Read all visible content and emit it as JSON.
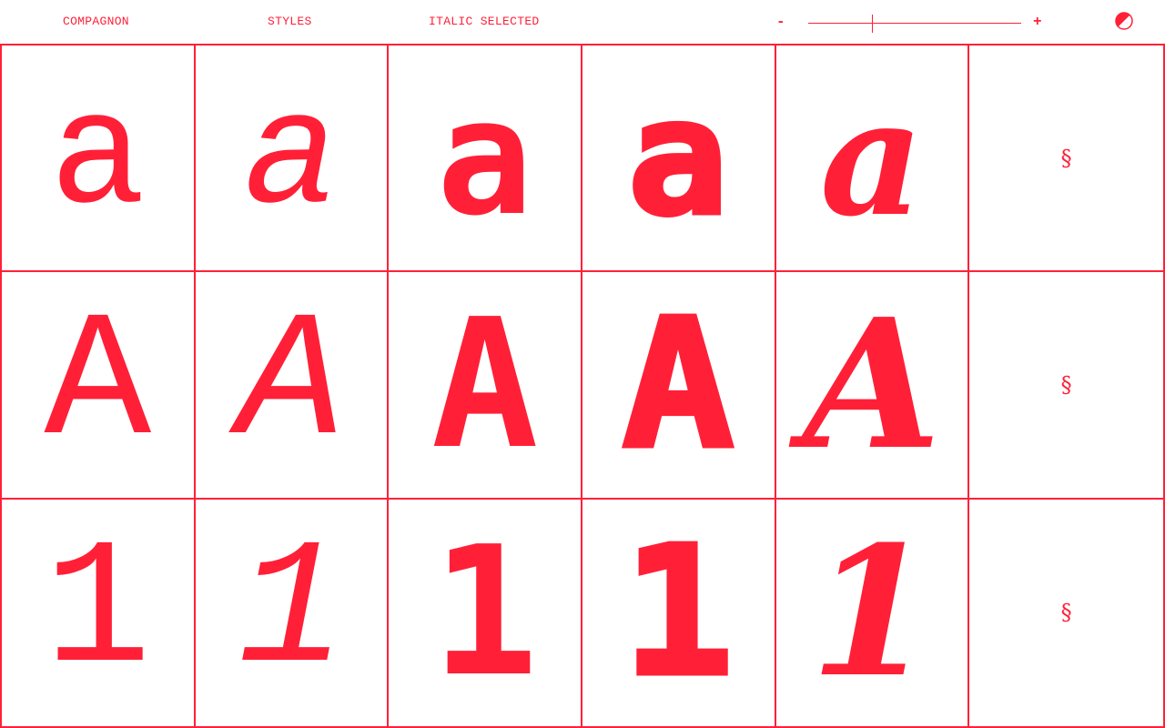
{
  "colors": {
    "accent": "#ff2038",
    "background": "#ffffff"
  },
  "header": {
    "brand": "COMPAGNON",
    "styles_link": "STYLES",
    "selected_label": "ITALIC SELECTED",
    "zoom": {
      "minus": "-",
      "plus": "+",
      "level": 0.3
    },
    "theme_toggle_icon": "contrast-icon"
  },
  "grid": {
    "rows": [
      {
        "cells": [
          "a",
          "a",
          "a",
          "a",
          "a",
          "§"
        ]
      },
      {
        "cells": [
          "A",
          "A",
          "A",
          "A",
          "A",
          "§"
        ]
      },
      {
        "cells": [
          "1",
          "1",
          "1",
          "1",
          "1",
          "§"
        ]
      }
    ],
    "column_styles": [
      "roman",
      "italic",
      "bold",
      "black",
      "script",
      "more"
    ],
    "more_icon": "section-sign-icon"
  }
}
